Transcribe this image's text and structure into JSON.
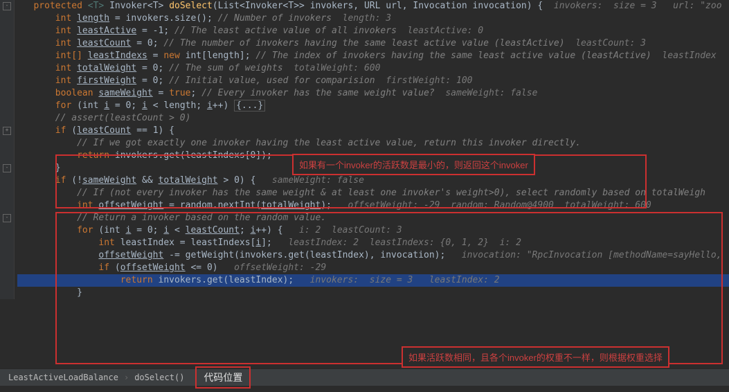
{
  "code": {
    "sig_protected": "protected",
    "sig_generic": "<T>",
    "sig_rettype": "Invoker<T>",
    "sig_method": "doSelect",
    "sig_params": "(List<Invoker<T>> invokers, URL url, Invocation invocation) {",
    "sig_hint": "  invokers:  size = 3   url: \"zoo",
    "l1_a": "int",
    "l1_b": "length",
    "l1_c": " = invokers.size(); ",
    "l1_cm": "// Number of invokers",
    "l1_h": "  length: 3",
    "l2_a": "int",
    "l2_b": "leastActive",
    "l2_c": " = -1; ",
    "l2_cm": "// The least active value of all invokers",
    "l2_h": "  leastActive: 0",
    "l3_a": "int",
    "l3_b": "leastCount",
    "l3_c": " = 0; ",
    "l3_cm": "// The number of invokers having the same least active value (leastActive)",
    "l3_h": "  leastCount: 3",
    "l4_a": "int[]",
    "l4_b": "leastIndexs",
    "l4_c": " = ",
    "l4_d": "new",
    "l4_e": " int[length]; ",
    "l4_cm": "// The index of invokers having the same least active value (leastActive)",
    "l4_h": "  leastIndex",
    "l5_a": "int",
    "l5_b": "totalWeight",
    "l5_c": " = 0; ",
    "l5_cm": "// The sum of weights",
    "l5_h": "  totalWeight: 600",
    "l6_a": "int",
    "l6_b": "firstWeight",
    "l6_c": " = 0; ",
    "l6_cm": "// Initial value, used for comparision",
    "l6_h": "  firstWeight: 100",
    "l7_a": "boolean",
    "l7_b": "sameWeight",
    "l7_c": " = ",
    "l7_d": "true",
    "l7_e": "; ",
    "l7_cm": "// Every invoker has the same weight value?",
    "l7_h": "  sameWeight: false",
    "lfor_a": "for",
    "lfor_b": " (int ",
    "lfor_c": "i",
    "lfor_d": " = 0; ",
    "lfor_e": "i",
    "lfor_f": " < length; ",
    "lfor_g": "i",
    "lfor_h": "++) ",
    "lfor_fold": "{...}",
    "lassert": "// assert(leastCount > 0)",
    "lif1_a": "if",
    "lif1_b": " (",
    "lif1_c": "leastCount",
    "lif1_d": " == 1) {",
    "lif1_cm": "// If we got exactly one invoker having the least active value, return this invoker directly.",
    "lif1_ret_a": "return",
    "lif1_ret_b": " invokers.get(leastIndexs[0]);",
    "lif1_close": "}",
    "lif2_a": "if",
    "lif2_b": " (!",
    "lif2_c": "sameWeight",
    "lif2_d": " && ",
    "lif2_e": "totalWeight",
    "lif2_f": " > 0) {",
    "lif2_h": "   sameWeight: false",
    "lif2_cm": "// If (not every invoker has the same weight & at least one invoker's weight>0), select randomly based on totalWeigh",
    "lif2_ow_a": "int",
    "lif2_ow_b": "offsetWeight",
    "lif2_ow_c": " = random.nextInt(",
    "lif2_ow_d": "totalWeight",
    "lif2_ow_e": ");",
    "lif2_ow_h": "   offsetWeight: -29  random: Random@4900  totalWeight: 600",
    "lif2_cm2": "// Return a invoker based on the random value.",
    "lif2_for_a": "for",
    "lif2_for_b": " (int ",
    "lif2_for_c": "i",
    "lif2_for_d": " = 0; ",
    "lif2_for_e": "i",
    "lif2_for_f": " < ",
    "lif2_for_g": "leastCount",
    "lif2_for_h": "; ",
    "lif2_for_i": "i",
    "lif2_for_j": "++) {",
    "lif2_for_hint": "   i: 2  leastCount: 3",
    "lif2_li_a": "int",
    "lif2_li_b": " leastIndex = leastIndexs[",
    "lif2_li_c": "i",
    "lif2_li_d": "];",
    "lif2_li_h": "   leastIndex: 2  leastIndexs: {0, 1, 2}  i: 2",
    "lif2_ow2_a": "offsetWeight",
    "lif2_ow2_b": " -= getWeight(invokers.get(leastIndex), invocation);",
    "lif2_ow2_h": "   invocation: \"RpcInvocation [methodName=sayHello,",
    "lif2_if_a": "if",
    "lif2_if_b": " (",
    "lif2_if_c": "offsetWeight",
    "lif2_if_d": " <= 0)",
    "lif2_if_h": "   offsetWeight: -29",
    "lif2_ret_a": "return",
    "lif2_ret_b": " invokers.get(leastIndex);",
    "lif2_ret_h": "   invokers:  size = 3   leastIndex: 2",
    "lif2_close": "}"
  },
  "annotations": {
    "box1_label": "如果有一个invoker的活跃数是最小的，则返回这个invoker",
    "box2_label": "如果活跃数相同，且各个invoker的权重不一样，则根据权重选择",
    "footer_label": "代码位置"
  },
  "breadcrumb": {
    "item1": "LeastActiveLoadBalance",
    "item2": "doSelect()"
  }
}
